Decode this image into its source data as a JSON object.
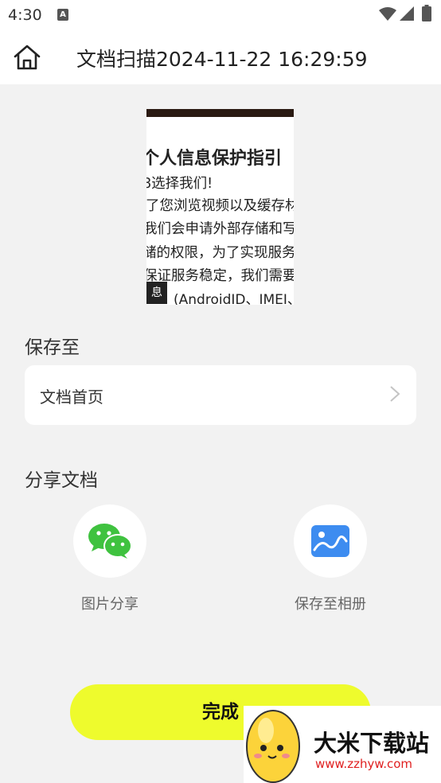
{
  "status_bar": {
    "time": "4:30",
    "notification_icon": "text-a-icon"
  },
  "header": {
    "title": "文档扫描2024-11-22 16:29:59",
    "home_icon": "home-icon"
  },
  "preview": {
    "title": "个人信息保护指引",
    "lines": [
      "8选择我们!",
      "了您浏览视频以及缓存材",
      "我们会申请外部存储和写",
      "储的权限，为了实现服务",
      "保证服务稳定，我们需要"
    ],
    "last_line": "(AndroidID、IMEI、",
    "badge": "息"
  },
  "save_section": {
    "label": "保存至",
    "destination": "文档首页"
  },
  "share_section": {
    "label": "分享文档",
    "items": [
      {
        "label": "图片分享",
        "icon": "wechat-icon"
      },
      {
        "label": "保存至相册",
        "icon": "gallery-icon"
      }
    ]
  },
  "done_button": {
    "label": "完成"
  },
  "watermark": {
    "title": "大米下载站",
    "url": "www.zzhyw.com"
  },
  "colors": {
    "accent": "#eefb2d",
    "wechat": "#3fc23f",
    "gallery": "#3d8cf0"
  }
}
